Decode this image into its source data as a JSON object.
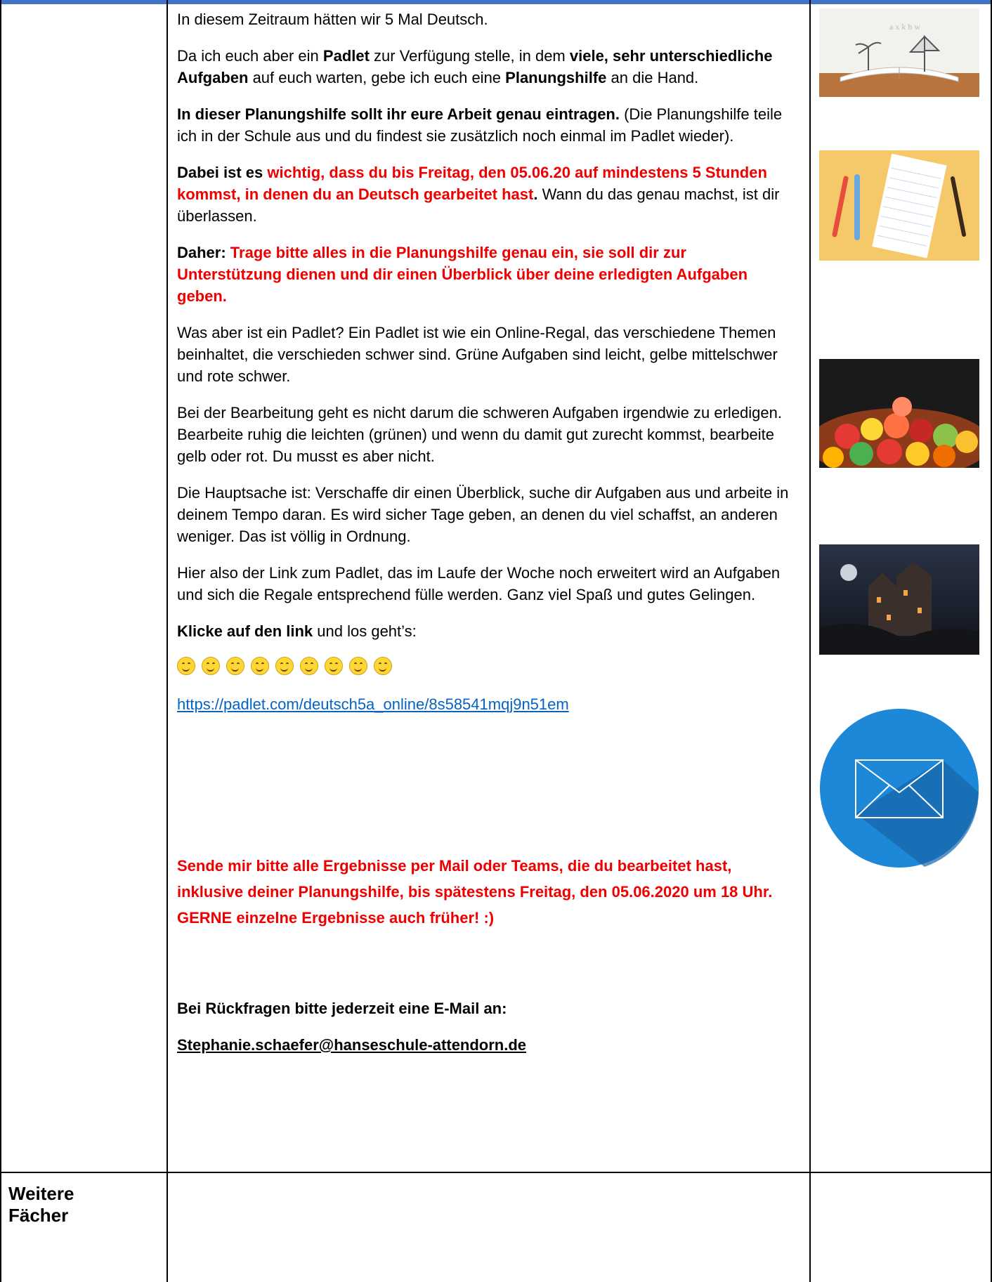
{
  "paragraphs": {
    "p1": "In diesem Zeitraum hätten wir 5 Mal Deutsch.",
    "p2a": "Da ich euch aber ein ",
    "p2b": "Padlet",
    "p2c": " zur Verfügung stelle, in dem ",
    "p2d": "viele, sehr unterschiedliche Aufgaben",
    "p2e": " auf euch warten, gebe ich euch eine ",
    "p2f": "Planungshilfe",
    "p2g": " an die Hand.",
    "p3a": "In dieser Planungshilfe sollt ihr eure Arbeit genau eintragen.",
    "p3b": " (Die Planungshilfe teile ich in der Schule aus und du findest sie zusätzlich noch einmal im Padlet wieder).",
    "p4a": "Dabei ist es ",
    "p4b": "wichtig, dass du bis Freitag, den 05.06.20 auf mindestens 5 Stunden kommst, in denen du an Deutsch gearbeitet hast",
    "p4c": ".",
    "p4d": " Wann du das genau machst, ist dir überlassen.",
    "p5a": "Daher: ",
    "p5b": "Trage bitte alles in die Planungshilfe genau ein, sie soll dir zur Unterstützung dienen und dir einen Überblick über deine erledigten Aufgaben geben.",
    "p6": "Was aber ist ein Padlet? Ein Padlet ist wie ein Online-Regal, das verschiedene Themen beinhaltet, die verschieden schwer sind. Grüne Aufgaben sind leicht, gelbe mittelschwer und rote schwer.",
    "p7": "Bei der Bearbeitung geht es nicht darum die schweren Aufgaben irgendwie zu erledigen. Bearbeite ruhig die leichten (grünen) und wenn du damit gut zurecht kommst, bearbeite gelb oder rot. Du musst es aber nicht.",
    "p8": "Die Hauptsache ist: Verschaffe dir einen Überblick, suche dir Aufgaben aus und arbeite in deinem Tempo daran. Es wird sicher Tage geben, an denen du viel schaffst, an anderen weniger. Das ist völlig in Ordnung.",
    "p9": "Hier also der Link zum Padlet, das im Laufe der Woche noch erweitert wird an Aufgaben und sich die Regale entsprechend fülle werden. Ganz viel Spaß und gutes Gelingen.",
    "p10a": "Klicke auf den link",
    "p10b": " und los geht’s:",
    "link": "https://padlet.com/deutsch5a_online/8s58541mqj9n51em",
    "deadline": "Sende mir bitte alle Ergebnisse per Mail oder Teams, die du bearbeitet hast, inklusive deiner Planungshilfe, bis spätestens Freitag, den 05.06.2020 um 18 Uhr. GERNE einzelne Ergebnisse auch früher! :)",
    "contact": "Bei Rückfragen bitte jederzeit eine E-Mail an:",
    "email": "Stephanie.schaefer@hanseschule-attendorn.de"
  },
  "smiley_count": 9,
  "side_label_line1": "Weitere",
  "side_label_line2": "Fächer",
  "icons": [
    "book-illustration",
    "notebook-pencils",
    "gummy-bears",
    "haunted-castle",
    "mail-icon"
  ]
}
